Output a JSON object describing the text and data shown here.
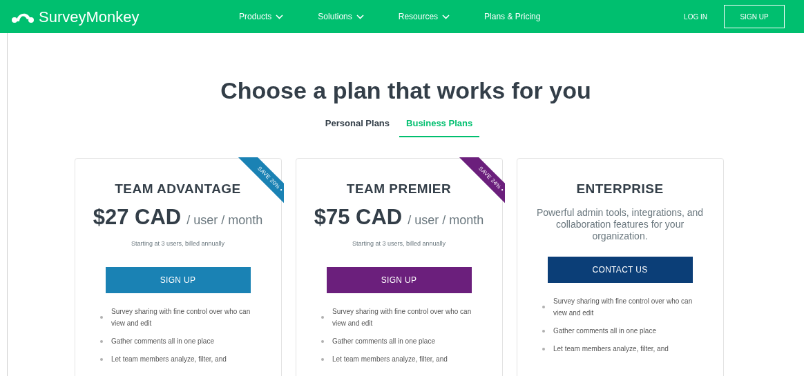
{
  "nav": {
    "logo": "SurveyMonkey",
    "menu": [
      {
        "label": "Products",
        "dropdown": true
      },
      {
        "label": "Solutions",
        "dropdown": true
      },
      {
        "label": "Resources",
        "dropdown": true
      },
      {
        "label": "Plans & Pricing",
        "dropdown": false
      }
    ],
    "login": "LOG IN",
    "signup": "SIGN UP"
  },
  "heading": "Choose a plan that works for you",
  "tabs": [
    {
      "label": "Personal Plans",
      "selected": false
    },
    {
      "label": "Business Plans",
      "selected": true
    }
  ],
  "plans": [
    {
      "name": "TEAM ADVANTAGE",
      "kind": "price",
      "price": "$27 CAD",
      "unit": "/ user / month",
      "note": "Starting at 3 users, billed annually",
      "ribbon": "SAVE 20% •",
      "color": "#1a82b4",
      "button": "SIGN UP",
      "features": [
        "Survey sharing with fine control over who can view and edit",
        "Gather comments all in one place",
        "Let team members analyze, filter, and"
      ]
    },
    {
      "name": "TEAM PREMIER",
      "kind": "price",
      "price": "$75 CAD",
      "unit": "/ user / month",
      "note": "Starting at 3 users, billed annually",
      "ribbon": "SAVE 24% •",
      "color": "#6b1f7c",
      "button": "SIGN UP",
      "features": [
        "Survey sharing with fine control over who can view and edit",
        "Gather comments all in one place",
        "Let team members analyze, filter, and"
      ]
    },
    {
      "name": "ENTERPRISE",
      "kind": "description",
      "description": "Powerful admin tools, integrations, and collaboration features for your organization.",
      "color": "#0b3e77",
      "button": "CONTACT US",
      "features": [
        "Survey sharing with fine control over who can view and edit",
        "Gather comments all in one place",
        "Let team members analyze, filter, and"
      ]
    }
  ]
}
